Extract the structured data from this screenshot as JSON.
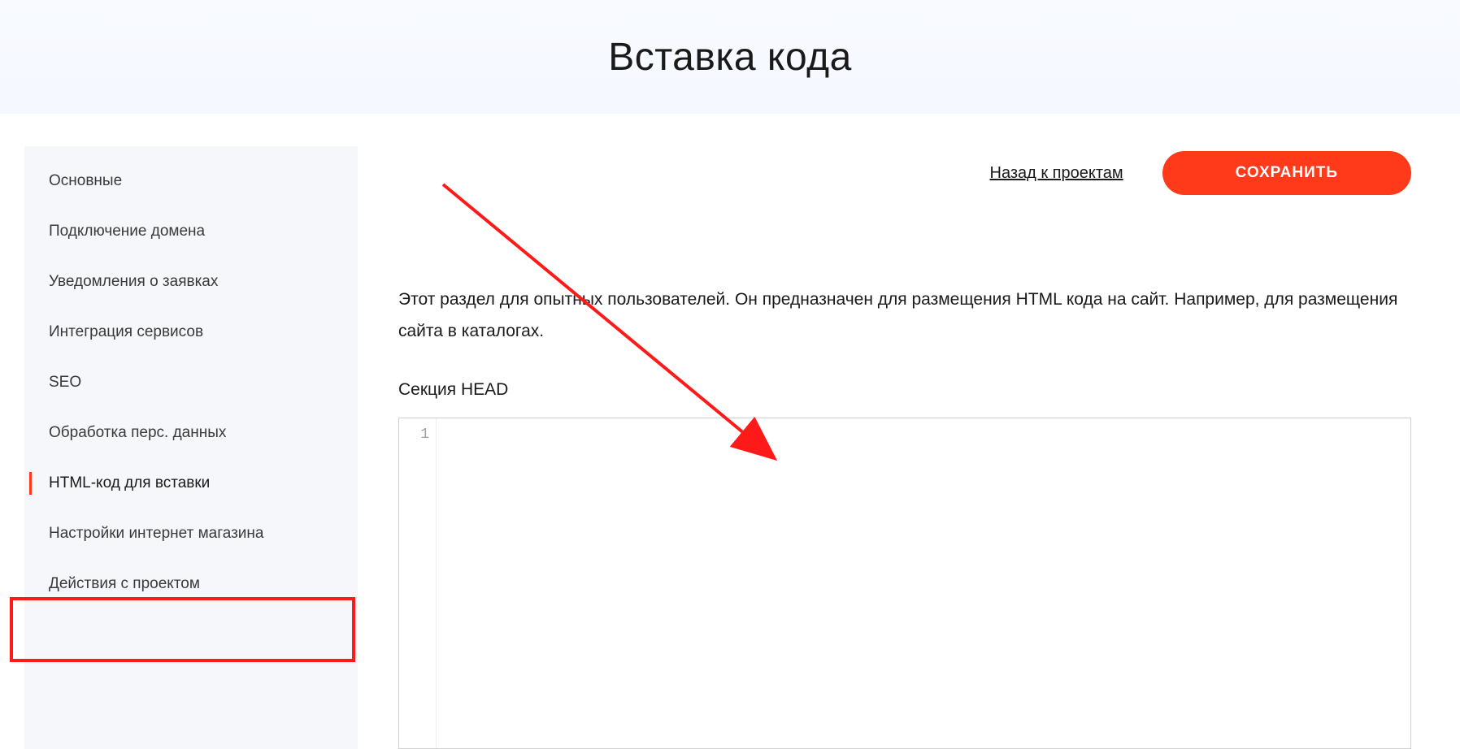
{
  "header": {
    "title": "Вставка кода"
  },
  "sidebar": {
    "items": [
      {
        "label": "Основные"
      },
      {
        "label": "Подключение домена"
      },
      {
        "label": "Уведомления о заявках"
      },
      {
        "label": "Интеграция сервисов"
      },
      {
        "label": "SEO"
      },
      {
        "label": "Обработка перс. данных"
      },
      {
        "label": "HTML-код для вставки"
      },
      {
        "label": "Настройки интернет магазина"
      },
      {
        "label": "Действия с проектом"
      }
    ],
    "active_index": 6
  },
  "main": {
    "back_link_label": "Назад к проектам",
    "save_button_label": "СОХРАНИТЬ",
    "description": "Этот раздел для опытных пользователей. Он предназначен для размещения HTML кода на сайт. Например, для размещения сайта в каталогах.",
    "section_head_label": "Секция HEAD",
    "code_editor": {
      "line_number": "1",
      "content": ""
    }
  },
  "annotations": {
    "highlight": {
      "target": "sidebar-item-html-code"
    },
    "arrow": {
      "color": "#ff1a1a"
    }
  }
}
